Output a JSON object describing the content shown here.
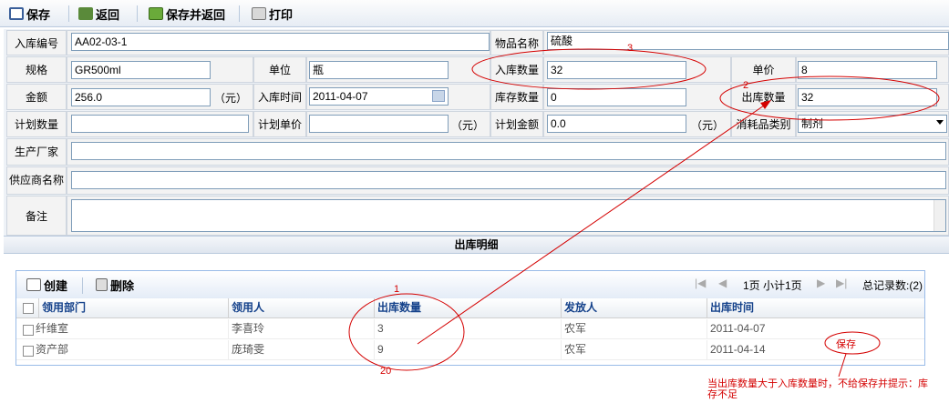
{
  "toolbar": {
    "save": "保存",
    "back": "返回",
    "save_back": "保存并返回",
    "print": "打印"
  },
  "form": {
    "in_no_label": "入库编号",
    "in_no_value": "AA02-03-1",
    "item_name_label": "物品名称",
    "item_name_value": "硫酸",
    "spec_label": "规格",
    "spec_value": "GR500ml",
    "unit_label": "单位",
    "unit_value": "瓶",
    "in_qty_label": "入库数量",
    "in_qty_value": "32",
    "price_label": "单价",
    "price_value": "8",
    "amount_label": "金额",
    "amount_value": "256.0",
    "yuan": "（元）",
    "in_time_label": "入库时间",
    "in_time_value": "2011-04-07",
    "stock_qty_label": "库存数量",
    "stock_qty_value": "0",
    "out_qty_label": "出库数量",
    "out_qty_value": "32",
    "plan_qty_label": "计划数量",
    "plan_qty_value": "",
    "plan_price_label": "计划单价",
    "plan_price_value": "",
    "plan_amount_label": "计划金额",
    "plan_amount_value": "0.0",
    "category_label": "消耗品类别",
    "category_value": "制剂",
    "manufacturer_label": "生产厂家",
    "supplier_label": "供应商名称",
    "remark_label": "备注"
  },
  "detail": {
    "title": "出库明细",
    "create": "创建",
    "delete": "删除",
    "page_info": "1页 小计1页",
    "total": "总记录数:(2)",
    "columns": [
      "领用部门",
      "领用人",
      "出库数量",
      "发放人",
      "出库时间"
    ],
    "rows": [
      [
        "纤维室",
        "李喜玲",
        "3",
        "农军",
        "2011-04-07"
      ],
      [
        "资产部",
        "庞琦雯",
        "9",
        "农军",
        "2011-04-14"
      ]
    ]
  },
  "annotations": {
    "n1": "1",
    "n2": "2",
    "n3": "3",
    "n20": "20",
    "save_note": "保存",
    "note_line1": "当出库数量大于入库数量时，不给保存并提示：库",
    "note_line2": "存不足"
  },
  "colors": {
    "accent": "#15428b",
    "annotation": "#d40000",
    "label_bg": "#f3f3f3",
    "toolbar_top": "#fdfdfd",
    "toolbar_bottom": "#e6ecf4"
  }
}
